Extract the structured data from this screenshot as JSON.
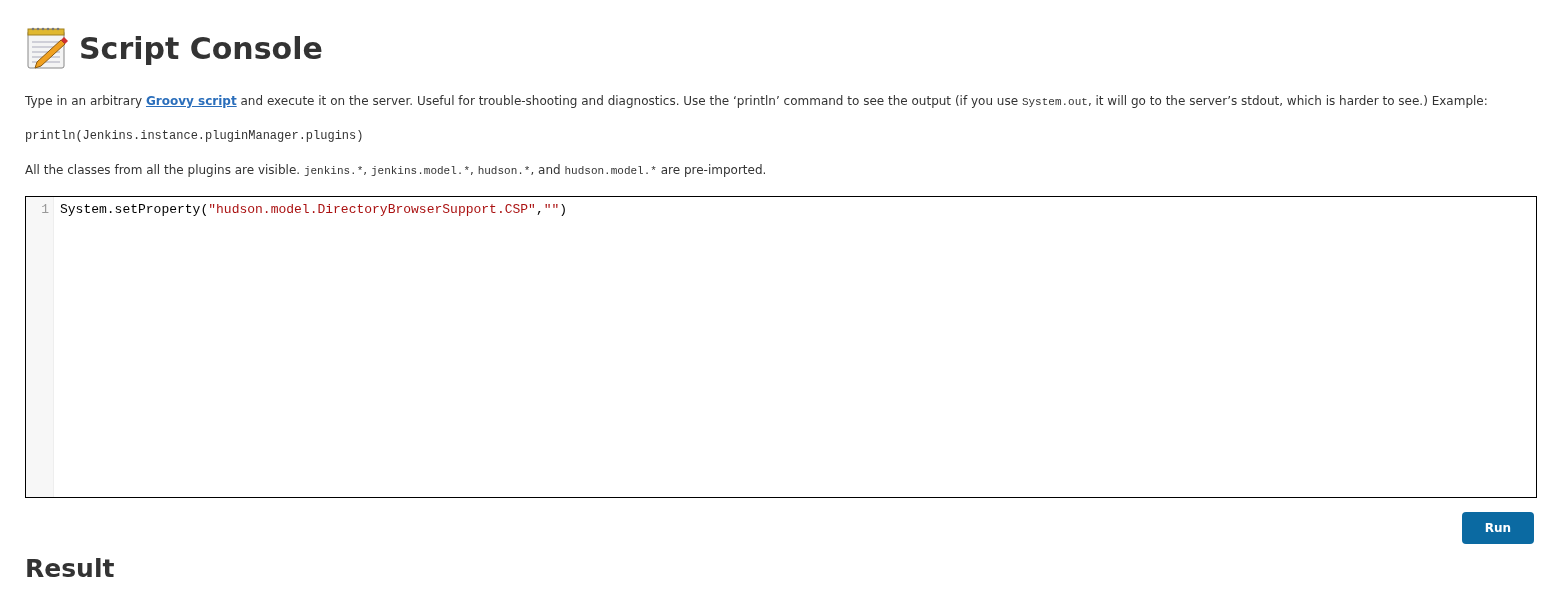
{
  "page": {
    "title": "Script Console"
  },
  "intro": [
    {
      "kind": "text",
      "text": "Type in an arbitrary "
    },
    {
      "kind": "link",
      "text": "Groovy script"
    },
    {
      "kind": "text",
      "text": " and execute it on the server. Useful for trouble-shooting and diagnostics. Use the ‘println’ command to see the output (if you use "
    },
    {
      "kind": "code",
      "text": "System.out"
    },
    {
      "kind": "text",
      "text": ", it will go to the server’s stdout, which is harder to see.) Example:"
    }
  ],
  "example": "println(Jenkins.instance.pluginManager.plugins)",
  "imports": [
    {
      "kind": "text",
      "text": "All the classes from all the plugins are visible. "
    },
    {
      "kind": "code",
      "text": "jenkins.*"
    },
    {
      "kind": "text",
      "text": ", "
    },
    {
      "kind": "code",
      "text": "jenkins.model.*"
    },
    {
      "kind": "text",
      "text": ", "
    },
    {
      "kind": "code",
      "text": "hudson.*"
    },
    {
      "kind": "text",
      "text": ", and "
    },
    {
      "kind": "code",
      "text": "hudson.model.*"
    },
    {
      "kind": "text",
      "text": " are pre-imported."
    }
  ],
  "editor": {
    "lines": [
      {
        "number": "1",
        "tokens": [
          {
            "kind": "plain",
            "text": "System.setProperty("
          },
          {
            "kind": "string",
            "text": "\"hudson.model.DirectoryBrowserSupport.CSP\""
          },
          {
            "kind": "plain",
            "text": ","
          },
          {
            "kind": "string",
            "text": "\"\""
          },
          {
            "kind": "plain",
            "text": ")"
          }
        ]
      }
    ]
  },
  "run_button": "Run",
  "result_heading": "Result"
}
